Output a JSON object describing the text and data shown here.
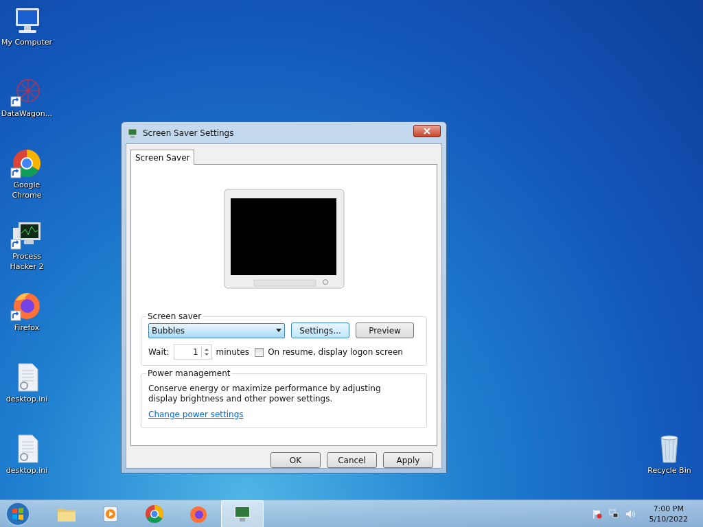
{
  "desktop_icons": [
    {
      "label": "My Computer",
      "kind": "computer",
      "shortcut": false
    },
    {
      "label": "DataWagon...",
      "kind": "network-graph",
      "shortcut": true
    },
    {
      "label": "Google Chrome",
      "kind": "chrome",
      "shortcut": true
    },
    {
      "label": "Process Hacker 2",
      "kind": "monitor-graph",
      "shortcut": true
    },
    {
      "label": "Firefox",
      "kind": "firefox",
      "shortcut": true
    },
    {
      "label": "desktop.ini",
      "kind": "file",
      "shortcut": false
    },
    {
      "label": "desktop.ini",
      "kind": "file",
      "shortcut": false
    }
  ],
  "recycle_bin": {
    "label": "Recycle Bin"
  },
  "window": {
    "title": "Screen Saver Settings",
    "tabs": [
      {
        "label": "Screen Saver",
        "selected": true
      }
    ],
    "screen_saver": {
      "legend": "Screen saver",
      "choice": "Bubbles",
      "settings_button": "Settings...",
      "preview_button": "Preview",
      "wait_label": "Wait:",
      "wait_value": "1",
      "minutes_label": "minutes",
      "logon_checkbox": {
        "label": "On resume, display logon screen",
        "checked": false
      }
    },
    "power": {
      "legend": "Power management",
      "text": "Conserve energy or maximize performance by adjusting display brightness and other power settings.",
      "link": "Change power settings"
    },
    "buttons": [
      "OK",
      "Cancel",
      "Apply"
    ]
  },
  "taskbar": {
    "apps": [
      {
        "kind": "folder",
        "selected": false
      },
      {
        "kind": "media",
        "selected": false
      },
      {
        "kind": "chrome",
        "selected": false
      },
      {
        "kind": "firefox",
        "selected": false
      },
      {
        "kind": "monitor",
        "selected": true
      }
    ],
    "time": "7:00 PM",
    "date": "5/10/2022"
  }
}
